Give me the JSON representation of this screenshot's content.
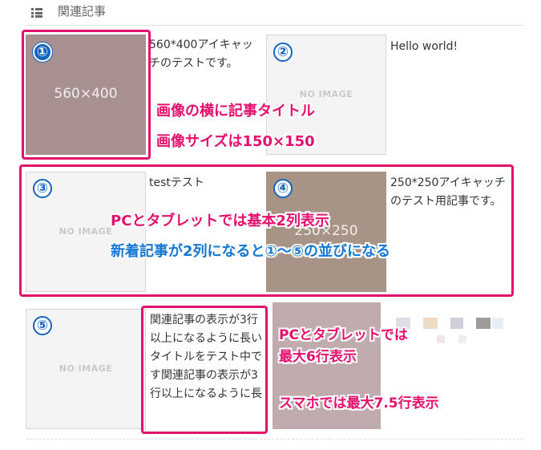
{
  "header": {
    "title": "関連記事",
    "icon": "list-icon"
  },
  "articles": [
    {
      "num": "①",
      "thumb_text": "560×400",
      "title": "560*400アイキャッチのテストです。"
    },
    {
      "num": "②",
      "thumb_text": "NO IMAGE",
      "title": "Hello world!"
    },
    {
      "num": "③",
      "thumb_text": "NO IMAGE",
      "title": "testテスト"
    },
    {
      "num": "④",
      "thumb_text": "250×250",
      "title": "250*250アイキャッチのテスト用記事です。"
    },
    {
      "num": "⑤",
      "thumb_text": "NO IMAGE",
      "title": "関連記事の表示が3行以上になるように長いタイトルをテスト中です関連記事の表示が3行以上になるように長"
    }
  ],
  "annotations": {
    "a1_line1": "画像の横に記事タイトル",
    "a1_line2": "画像サイズは150×150",
    "a2_line1": "PCとタブレットでは基本2列表示",
    "a2_line2": "新着記事が2列になると①～⑤の並びになる",
    "a3_line1": "PCとタブレットでは",
    "a3_line2": "最大6行表示",
    "a3_line3": "スマホでは最大7.5行表示"
  },
  "colors": {
    "annotation_pink": "#e5106e",
    "annotation_blue": "#1478d4",
    "badge_blue": "#1565c0",
    "thumb1_bg": "#a89090",
    "thumb4_bg": "#a89486",
    "thumb6_bg": "#c0acae"
  }
}
